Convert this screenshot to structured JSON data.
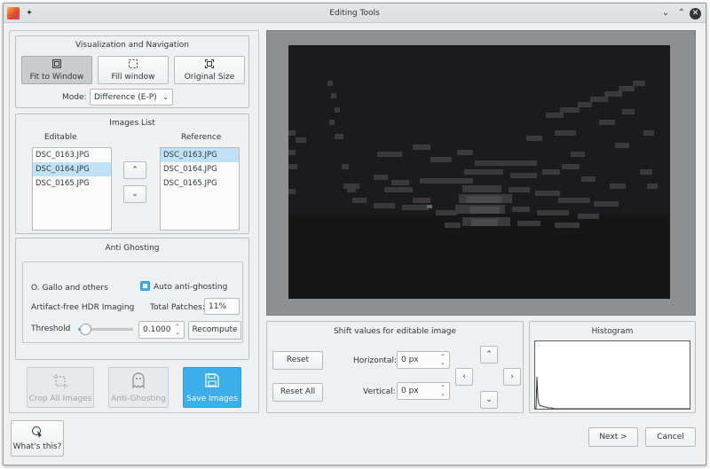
{
  "window": {
    "title": "Editing Tools"
  },
  "visualization": {
    "title": "Visualization and Navigation",
    "fit_label": "Fit to Window",
    "fill_label": "Fill window",
    "original_label": "Original Size",
    "mode_label": "Mode:",
    "mode_value": "Difference (E-P)"
  },
  "images_list": {
    "title": "Images List",
    "editable_header": "Editable",
    "reference_header": "Reference",
    "editable_items": [
      "DSC_0163.JPG",
      "DSC_0164.JPG",
      "DSC_0165.JPG"
    ],
    "reference_items": [
      "DSC_0163.JPG",
      "DSC_0164.JPG",
      "DSC_0165.JPG"
    ]
  },
  "anti_ghosting": {
    "title": "Anti Ghosting",
    "author": "O. Gallo and others",
    "auto_label": "Auto anti-ghosting",
    "method": "Artifact-free HDR Imaging",
    "patches_label": "Total Patches:",
    "patches_value": "11%",
    "threshold_label": "Threshold",
    "threshold_value": "0.1000",
    "threshold_fraction": 0.05,
    "recompute_label": "Recompute"
  },
  "actions": {
    "crop_label": "Crop All Images",
    "antighost_label": "Anti-Ghosting",
    "save_label": "Save Images"
  },
  "shift": {
    "title": "Shift values for editable image",
    "reset_label": "Reset",
    "reset_all_label": "Reset All",
    "horizontal_label": "Horizontal:",
    "horizontal_value": "0 px",
    "vertical_label": "Vertical:",
    "vertical_value": "0 px"
  },
  "histogram": {
    "title": "Histogram"
  },
  "footer": {
    "whats_this_label": "What's this?",
    "next_label": "Next >",
    "cancel_label": "Cancel"
  },
  "colors": {
    "accent": "#3daee9",
    "selection": "#bfe2f7",
    "window_bg": "#eff0f1",
    "preview_frame": "#8e8f91",
    "preview_image": "#1c1c1e"
  },
  "icons": [
    "pin-icon",
    "fit-window-icon",
    "fill-window-icon",
    "original-size-icon",
    "crop-icon",
    "ghost-icon",
    "save-disk-icon",
    "whats-this-pointer-icon"
  ]
}
